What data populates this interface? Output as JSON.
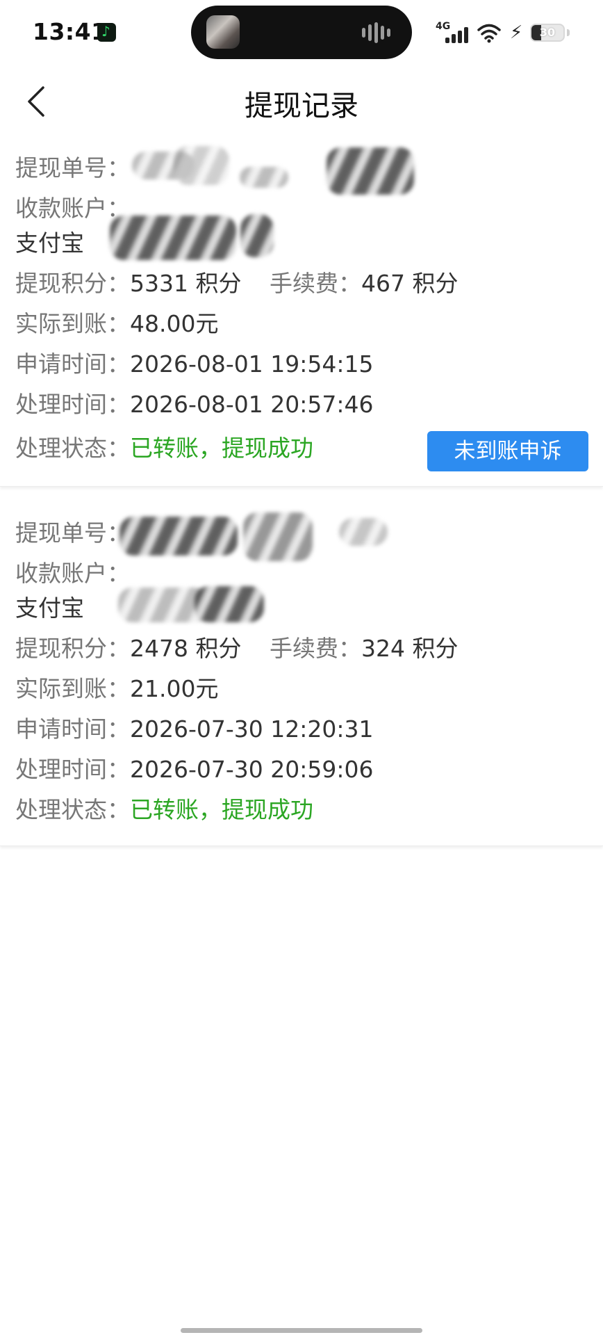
{
  "status_bar": {
    "time": "13:41",
    "network": "4G",
    "battery": "30",
    "battery_level": 0.3,
    "icons": [
      "music-app-icon",
      "signal-icon",
      "wifi-icon",
      "charging-bolt-icon",
      "battery-icon"
    ]
  },
  "header": {
    "title": "提现记录",
    "back_icon": "chevron-left-icon"
  },
  "records": [
    {
      "order_label": "提现单号：",
      "account_label": "收款账户：",
      "account_type": "支付宝",
      "points_label": "提现积分：",
      "points": "5331 积分",
      "fee_label": "手续费：",
      "fee": "467 积分",
      "received_label": "实际到账：",
      "received": "48.00元",
      "apply_time_label": "申请时间：",
      "apply_time": "2026-08-01 19:54:15",
      "process_time_label": "处理时间：",
      "process_time": "2026-08-01 20:57:46",
      "status_label": "处理状态：",
      "status": "已转账，提现成功",
      "action": "未到账申诉"
    },
    {
      "order_label": "提现单号：",
      "account_label": "收款账户：",
      "account_type": "支付宝",
      "points_label": "提现积分：",
      "points": "2478 积分",
      "fee_label": "手续费：",
      "fee": "324 积分",
      "received_label": "实际到账：",
      "received": "21.00元",
      "apply_time_label": "申请时间：",
      "apply_time": "2026-07-30 12:20:31",
      "process_time_label": "处理时间：",
      "process_time": "2026-07-30 20:59:06",
      "status_label": "处理状态：",
      "status": "已转账，提现成功"
    }
  ],
  "colors": {
    "success": "#2ba623",
    "primary_button": "#2d8cf0",
    "label": "#777777",
    "value": "#333333"
  }
}
